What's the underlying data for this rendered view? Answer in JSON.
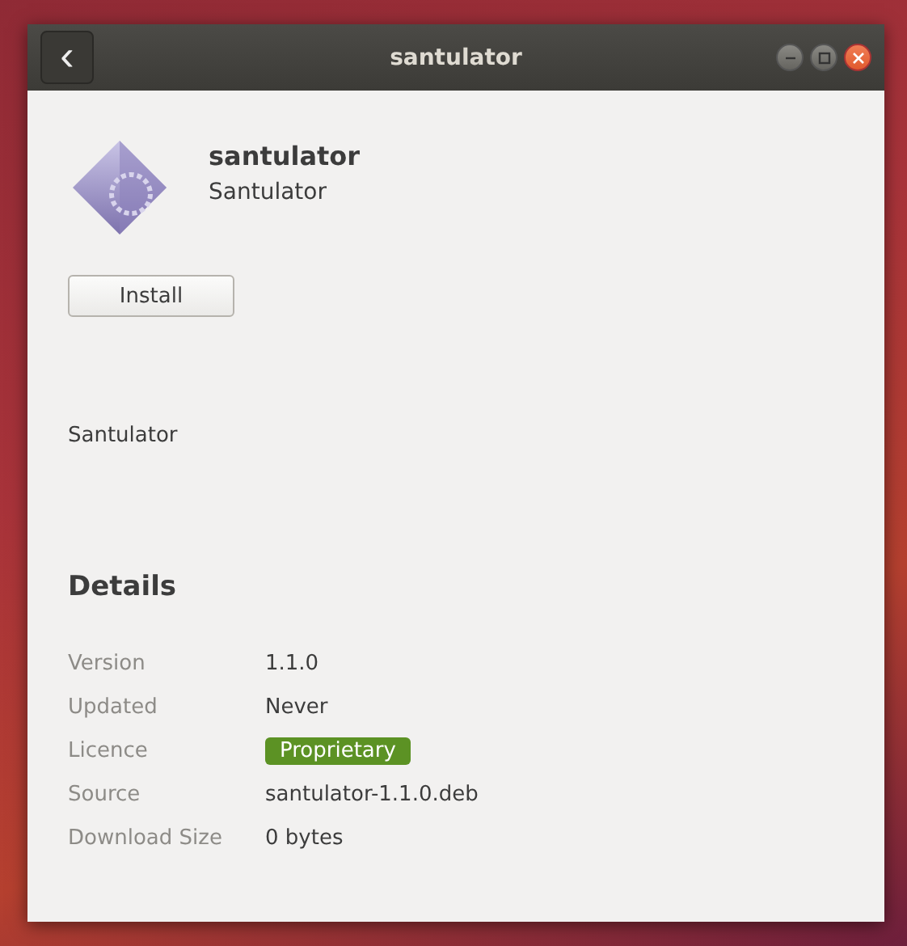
{
  "window": {
    "title": "santulator",
    "back_button": "‹"
  },
  "app": {
    "name": "santulator",
    "summary": "Santulator",
    "install_button": "Install",
    "description": "Santulator"
  },
  "details": {
    "heading": "Details",
    "rows": [
      {
        "label": "Version",
        "value": "1.1.0",
        "kind": "text"
      },
      {
        "label": "Updated",
        "value": "Never",
        "kind": "text"
      },
      {
        "label": "Licence",
        "value": "Proprietary",
        "kind": "badge"
      },
      {
        "label": "Source",
        "value": "santulator-1.1.0.deb",
        "kind": "text"
      },
      {
        "label": "Download Size",
        "value": "0 bytes",
        "kind": "text"
      }
    ]
  }
}
